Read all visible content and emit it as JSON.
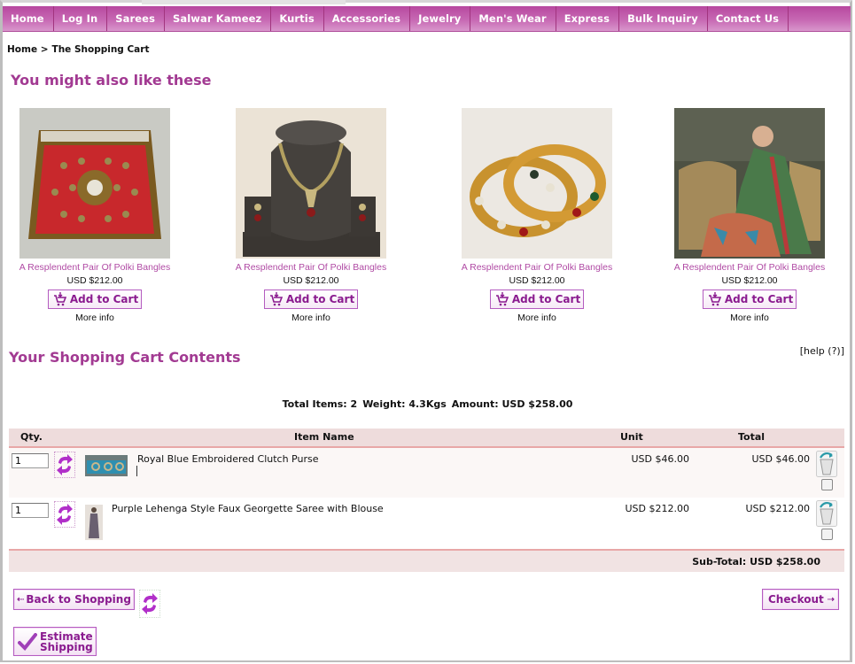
{
  "nav": {
    "items": [
      "Home",
      "Log In",
      "Sarees",
      "Salwar Kameez",
      "Kurtis",
      "Accessories",
      "Jewelry",
      "Men's Wear",
      "Express",
      "Bulk Inquiry",
      "Contact Us"
    ]
  },
  "breadcrumb": {
    "home": "Home >",
    "current": "The Shopping Cart"
  },
  "recommendations": {
    "title": "You might also like these",
    "products": [
      {
        "name": "A Resplendent Pair Of Polki Bangles",
        "price": "USD $212.00",
        "add_label": "Add to Cart",
        "more_label": "More info",
        "image": "red-embroidered-clutch"
      },
      {
        "name": "A Resplendent Pair Of Polki Bangles",
        "price": "USD $212.00",
        "add_label": "Add to Cart",
        "more_label": "More info",
        "image": "necklace-set-on-bust"
      },
      {
        "name": "A Resplendent Pair Of Polki Bangles",
        "price": "USD $212.00",
        "add_label": "Add to Cart",
        "more_label": "More info",
        "image": "gold-polki-bangles"
      },
      {
        "name": "A Resplendent Pair Of Polki Bangles",
        "price": "USD $212.00",
        "add_label": "Add to Cart",
        "more_label": "More info",
        "image": "model-in-green-saree"
      }
    ]
  },
  "cart": {
    "title": "Your Shopping Cart Contents",
    "help": "[help (?)]",
    "summary": {
      "items": "Total Items: 2",
      "weight": "Weight: 4.3Kgs",
      "amount": "Amount: USD $258.00"
    },
    "columns": {
      "qty": "Qty.",
      "item": "Item Name",
      "unit": "Unit",
      "total": "Total"
    },
    "rows": [
      {
        "qty": "1",
        "name": "Royal Blue Embroidered Clutch Purse",
        "unit": "USD $46.00",
        "total": "USD $46.00"
      },
      {
        "qty": "1",
        "name": "Purple Lehenga Style Faux Georgette Saree with Blouse",
        "unit": "USD $212.00",
        "total": "USD $212.00"
      }
    ],
    "subtotal": "Sub-Total: USD $258.00"
  },
  "buttons": {
    "back": "Back to Shopping",
    "checkout": "Checkout",
    "estimate_line1": "Estimate",
    "estimate_line2": "Shipping"
  },
  "colors": {
    "brand": "#b7489f",
    "heading": "#a23a92",
    "button_text": "#8a1b8f"
  }
}
